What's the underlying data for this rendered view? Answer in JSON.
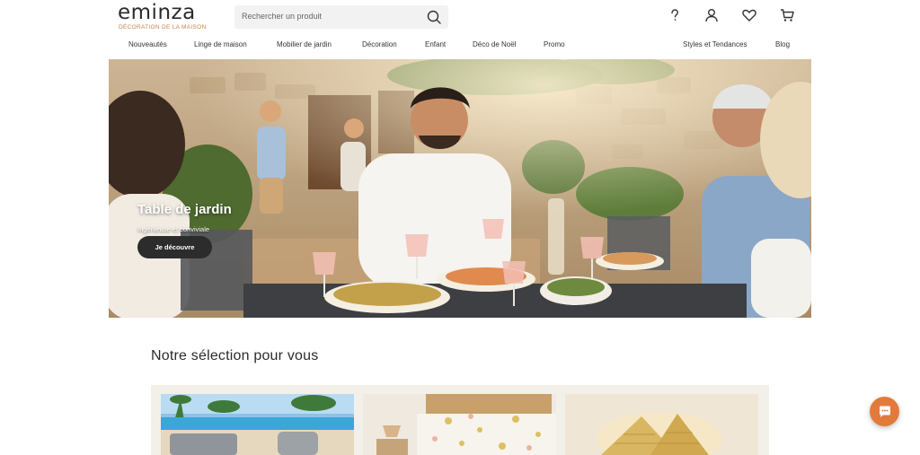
{
  "brand": {
    "name": "eminza",
    "tagline": "DÉCORATION DE LA MAISON",
    "accent_color": "#c5834c"
  },
  "search": {
    "placeholder": "Rechercher un produit"
  },
  "header_icons": [
    "help-icon",
    "account-icon",
    "wishlist-heart-icon",
    "cart-icon"
  ],
  "nav": {
    "items": [
      "Nouveautés",
      "Linge de maison",
      "Mobilier de jardin",
      "Décoration",
      "Enfant",
      "Déco de Noël",
      "Promo"
    ],
    "right_items": [
      "Styles et Tendances",
      "Blog"
    ]
  },
  "hero": {
    "title": "Table de jardin",
    "subtitle": "Ingénieuse et conviviale",
    "cta_label": "Je découvre"
  },
  "selection": {
    "title": "Notre sélection pour vous"
  },
  "chat": {
    "icon": "chat-bubble-icon",
    "color": "#e27a3c"
  }
}
